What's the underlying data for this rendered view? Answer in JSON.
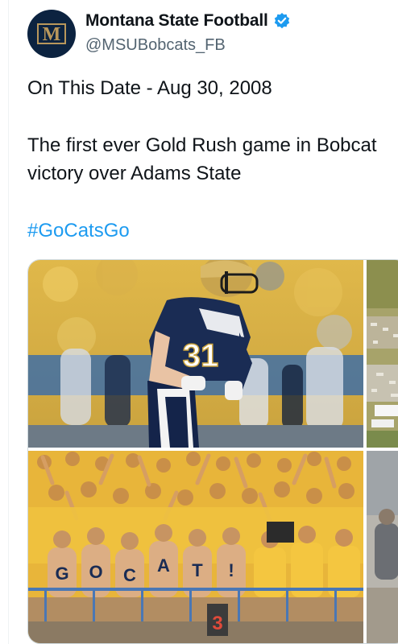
{
  "author": {
    "display_name": "Montana State Football",
    "handle": "@MSUBobcats_FB",
    "avatar_letter": "M",
    "verified_color": "#1d9bf0",
    "brand_navy": "#0c2340",
    "brand_gold": "#b9975b"
  },
  "tweet": {
    "line1": "On This Date - Aug 30, 2008",
    "line2": "The first ever Gold Rush game in Bobcat",
    "line3": "victory over Adams State",
    "hashtag": "#GoCatsGo",
    "hashtag_color": "#1d9bf0"
  },
  "media": {
    "photo_football_player_jersey": "31",
    "photo_fans_letters": [
      "G",
      "O",
      "C",
      "A",
      "T",
      "!"
    ],
    "photo_fans_sign": "3"
  },
  "icons": {
    "verified": "verified-badge-icon",
    "avatar": "msu-logo-icon"
  }
}
